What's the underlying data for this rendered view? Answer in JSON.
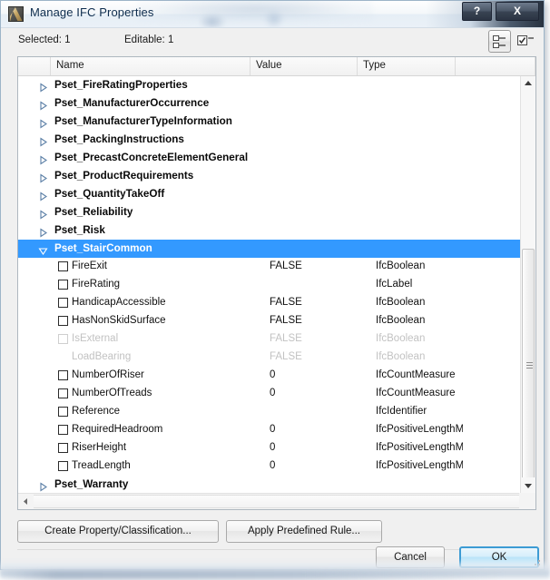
{
  "window": {
    "title": "Manage IFC Properties",
    "icon": "app-icon",
    "help_label": "?",
    "close_label": "X"
  },
  "status": {
    "selected": "Selected: 1",
    "editable": "Editable: 1"
  },
  "toolbar": {
    "tree_view_icon": "tree-view-icon",
    "checkbox_toggle_icon": "checkbox-toggle-icon"
  },
  "table": {
    "columns": [
      "",
      "Name",
      "Value",
      "Type"
    ],
    "rows": [
      {
        "kind": "group",
        "name": "Pset_FireRatingProperties",
        "expanded": false,
        "value": "",
        "type": ""
      },
      {
        "kind": "group",
        "name": "Pset_ManufacturerOccurrence",
        "expanded": false,
        "value": "",
        "type": ""
      },
      {
        "kind": "group",
        "name": "Pset_ManufacturerTypeInformation",
        "expanded": false,
        "value": "",
        "type": ""
      },
      {
        "kind": "group",
        "name": "Pset_PackingInstructions",
        "expanded": false,
        "value": "",
        "type": ""
      },
      {
        "kind": "group",
        "name": "Pset_PrecastConcreteElementGeneral",
        "expanded": false,
        "value": "",
        "type": ""
      },
      {
        "kind": "group",
        "name": "Pset_ProductRequirements",
        "expanded": false,
        "value": "",
        "type": ""
      },
      {
        "kind": "group",
        "name": "Pset_QuantityTakeOff",
        "expanded": false,
        "value": "",
        "type": ""
      },
      {
        "kind": "group",
        "name": "Pset_Reliability",
        "expanded": false,
        "value": "",
        "type": ""
      },
      {
        "kind": "group",
        "name": "Pset_Risk",
        "expanded": false,
        "value": "",
        "type": ""
      },
      {
        "kind": "group",
        "name": "Pset_StairCommon",
        "expanded": true,
        "selected": true,
        "value": "",
        "type": ""
      },
      {
        "kind": "prop",
        "name": "FireExit",
        "checked": false,
        "disabled": false,
        "value": "FALSE",
        "type": "IfcBoolean"
      },
      {
        "kind": "prop",
        "name": "FireRating",
        "checked": false,
        "disabled": false,
        "value": "",
        "type": "IfcLabel"
      },
      {
        "kind": "prop",
        "name": "HandicapAccessible",
        "checked": false,
        "disabled": false,
        "value": "FALSE",
        "type": "IfcBoolean"
      },
      {
        "kind": "prop",
        "name": "HasNonSkidSurface",
        "checked": false,
        "disabled": false,
        "value": "FALSE",
        "type": "IfcBoolean"
      },
      {
        "kind": "prop",
        "name": "IsExternal",
        "checked": false,
        "disabled": true,
        "value": "FALSE",
        "type": "IfcBoolean"
      },
      {
        "kind": "prop",
        "name": "LoadBearing",
        "nocheckbox": true,
        "disabled": true,
        "value": "FALSE",
        "type": "IfcBoolean"
      },
      {
        "kind": "prop",
        "name": "NumberOfRiser",
        "checked": false,
        "disabled": false,
        "value": "0",
        "type": "IfcCountMeasure"
      },
      {
        "kind": "prop",
        "name": "NumberOfTreads",
        "checked": false,
        "disabled": false,
        "value": "0",
        "type": "IfcCountMeasure"
      },
      {
        "kind": "prop",
        "name": "Reference",
        "checked": false,
        "disabled": false,
        "value": "",
        "type": "IfcIdentifier"
      },
      {
        "kind": "prop",
        "name": "RequiredHeadroom",
        "checked": false,
        "disabled": false,
        "value": "0",
        "type": "IfcPositiveLengthMea"
      },
      {
        "kind": "prop",
        "name": "RiserHeight",
        "checked": false,
        "disabled": false,
        "value": "0",
        "type": "IfcPositiveLengthMea"
      },
      {
        "kind": "prop",
        "name": "TreadLength",
        "checked": false,
        "disabled": false,
        "value": "0",
        "type": "IfcPositiveLengthMea"
      },
      {
        "kind": "group",
        "name": "Pset_Warranty",
        "expanded": false,
        "value": "",
        "type": ""
      }
    ]
  },
  "footer": {
    "create_label": "Create Property/Classification...",
    "apply_label": "Apply Predefined Rule...",
    "cancel_label": "Cancel",
    "ok_label": "OK"
  },
  "colors": {
    "selection_blue": "#3399ff",
    "default_button_border": "#3c9bd4",
    "disabled_text": "#c2c2c2",
    "window_bg": "#f0f0f0"
  }
}
